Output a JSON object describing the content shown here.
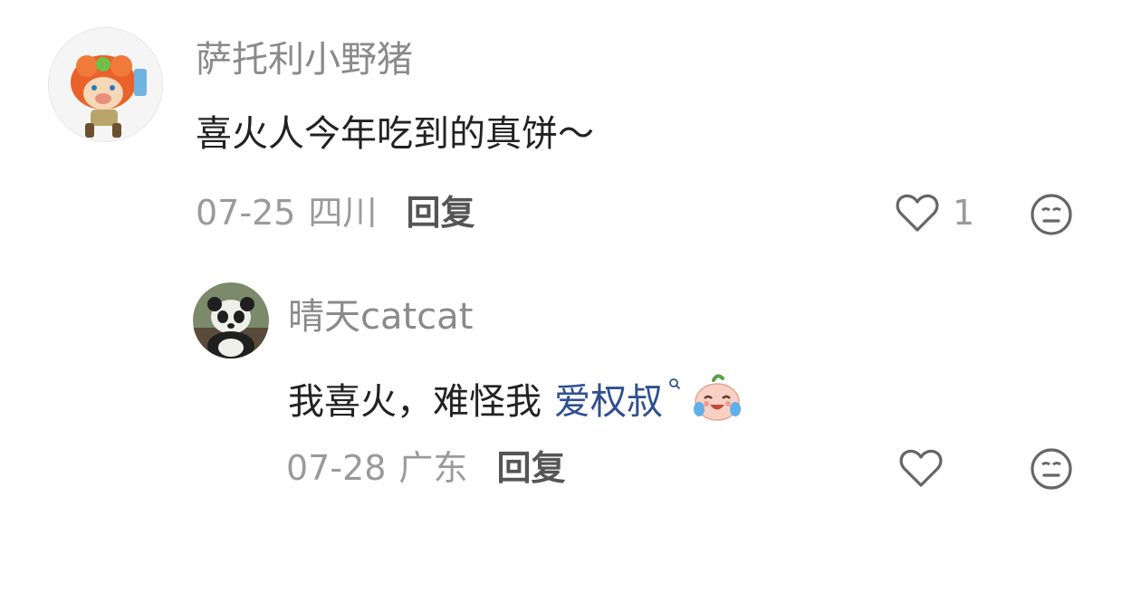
{
  "comments": [
    {
      "user": "萨托利小野猪",
      "text": "喜火人今年吃到的真饼～",
      "date": "07-25",
      "location": "四川",
      "reply_label": "回复",
      "like_count": "1"
    }
  ],
  "replies": [
    {
      "user": "晴天catcat",
      "text": "我喜火，难怪我",
      "mention": "爱权叔",
      "mention_icon": "search-icon",
      "emoji": "crying-laughing-face",
      "date": "07-28",
      "location": "广东",
      "reply_label": "回复"
    }
  ],
  "colors": {
    "meta_gray": "#9a9a9a",
    "username_gray": "#8a8a8a",
    "mention_blue": "#2f4f8f",
    "icon_gray": "#666666"
  }
}
